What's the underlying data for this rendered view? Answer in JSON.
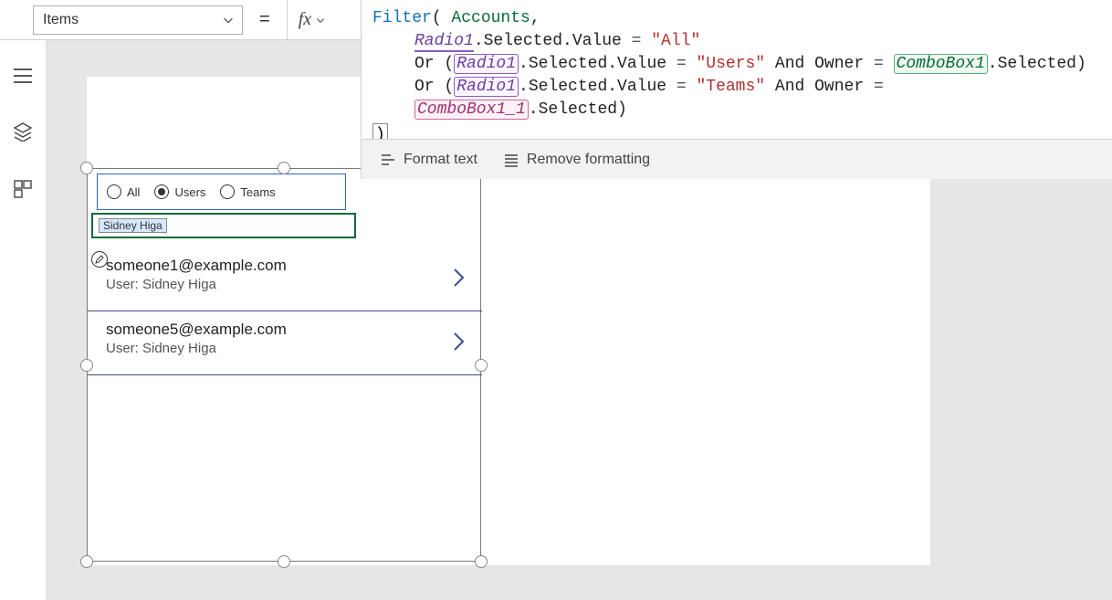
{
  "header": {
    "property": "Items",
    "equals": "="
  },
  "formula": {
    "fn": "Filter",
    "t_accounts": "Accounts",
    "t_radio": "Radio1",
    "t_selval": ".Selected.Value",
    "t_eq": " = ",
    "s_all": "\"All\"",
    "t_or": "Or",
    "s_users": "\"Users\"",
    "t_and": "And",
    "t_owner": "Owner",
    "t_combo1": "ComboBox1",
    "t_combo2": "ComboBox1_1",
    "t_sel": ".Selected",
    "close": ")"
  },
  "formatbar": {
    "format": "Format text",
    "remove": "Remove formatting"
  },
  "radio": {
    "opt1": "All",
    "opt2": "Users",
    "opt3": "Teams"
  },
  "combo": {
    "value": "Sidney Higa"
  },
  "rows": [
    {
      "email": "someone1@example.com",
      "sub": "User: Sidney Higa"
    },
    {
      "email": "someone5@example.com",
      "sub": "User: Sidney Higa"
    }
  ]
}
